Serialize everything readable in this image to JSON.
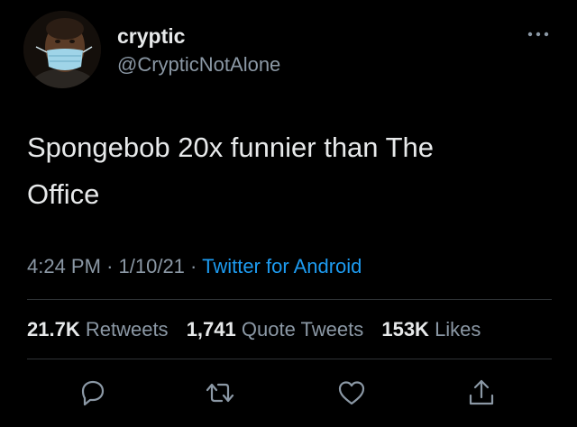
{
  "user": {
    "display_name": "cryptic",
    "handle": "@CrypticNotAlone",
    "avatar_icon": "profile-avatar"
  },
  "tweet": {
    "text_line1": "Spongebob 20x funnier than The",
    "text_line2": "Office",
    "time": "4:24 PM",
    "date": "1/10/21",
    "separator": "·",
    "source": "Twitter for Android"
  },
  "stats": {
    "retweets_count": "21.7K",
    "retweets_label": "Retweets",
    "quotes_count": "1,741",
    "quotes_label": "Quote Tweets",
    "likes_count": "153K",
    "likes_label": "Likes"
  },
  "actions": [
    "reply-icon",
    "retweet-icon",
    "like-icon",
    "share-icon"
  ],
  "colors": {
    "background": "#000000",
    "text": "#e7e9ea",
    "secondary": "#8b98a5",
    "link": "#1d9bf0",
    "divider": "#2f3336"
  }
}
